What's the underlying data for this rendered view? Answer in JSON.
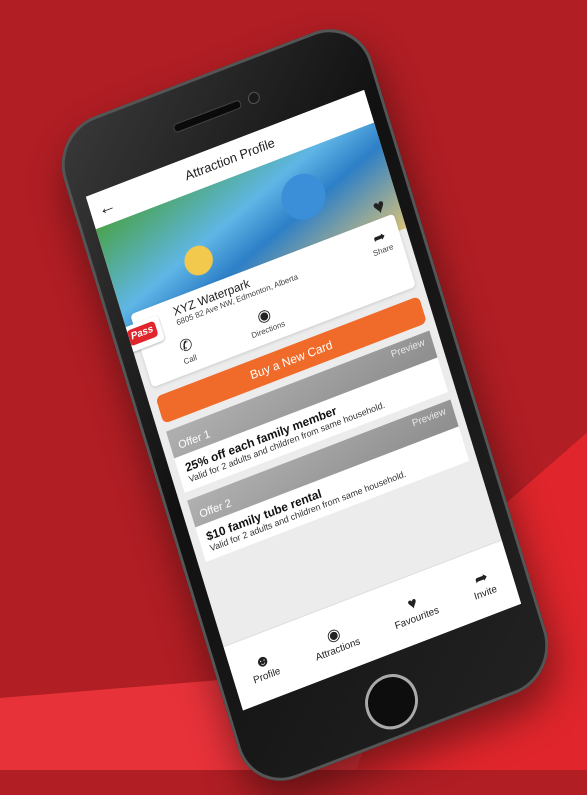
{
  "header": {
    "title": "Attraction Profile"
  },
  "attraction": {
    "name": "XYZ Waterpark",
    "address": "6805 82 Ave NW, Edmonton, Alberta",
    "logo_text": "Pass"
  },
  "actions": {
    "share": "Share",
    "call": "Call",
    "directions": "Directions"
  },
  "buy_label": "Buy a New Card",
  "offers": [
    {
      "label": "Offer 1",
      "preview": "Preview",
      "title": "25% off each family member",
      "desc": "Valid for 2 adults and children from same household."
    },
    {
      "label": "Offer 2",
      "preview": "Preview",
      "title": "$10 family tube rental",
      "desc": "Valid for 2 adults and children from same household."
    }
  ],
  "tabs": {
    "profile": "Profile",
    "attractions": "Attractions",
    "favourites": "Favourites",
    "invite": "Invite"
  },
  "colors": {
    "background": "#b11e24",
    "accent": "#f06b2a",
    "brand_red": "#e0262c"
  }
}
